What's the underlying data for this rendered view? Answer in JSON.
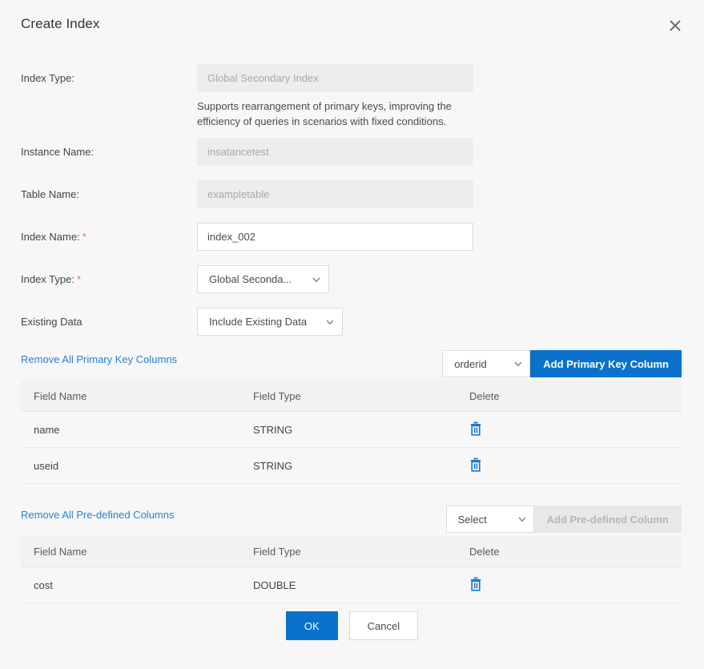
{
  "dialog": {
    "title": "Create Index",
    "close_icon": "close-icon"
  },
  "form": {
    "index_type_readonly": {
      "label": "Index Type:",
      "value": "Global Secondary Index",
      "helper": "Supports rearrangement of primary keys, improving the efficiency of queries in scenarios with fixed conditions."
    },
    "instance_name": {
      "label": "Instance Name:",
      "value": "insatancetest"
    },
    "table_name": {
      "label": "Table Name:",
      "value": "exampletable"
    },
    "index_name": {
      "label": "Index Name:",
      "required_mark": "*",
      "value": "index_002"
    },
    "index_type": {
      "label": "Index Type:",
      "required_mark": "*",
      "value": "Global Seconda..."
    },
    "existing_data": {
      "label": "Existing Data",
      "value": "Include Existing Data"
    }
  },
  "primary_key_section": {
    "remove_all_link": "Remove All Primary Key Columns",
    "select_value": "orderid",
    "add_button": "Add Primary Key Column",
    "columns": [
      "Field Name",
      "Field Type",
      "Delete"
    ],
    "rows": [
      {
        "field_name": "name",
        "field_type": "STRING",
        "delete_icon": "trash-icon"
      },
      {
        "field_name": "useid",
        "field_type": "STRING",
        "delete_icon": "trash-icon"
      }
    ]
  },
  "predefined_section": {
    "remove_all_link": "Remove All Pre-defined Columns",
    "select_value": "Select",
    "add_button": "Add Pre-defined Column",
    "columns": [
      "Field Name",
      "Field Type",
      "Delete"
    ],
    "rows": [
      {
        "field_name": "cost",
        "field_type": "DOUBLE",
        "delete_icon": "trash-icon"
      }
    ]
  },
  "footer": {
    "ok_label": "OK",
    "cancel_label": "Cancel"
  },
  "colors": {
    "primary_blue": "#0a72cc",
    "link_blue": "#2b7fd3",
    "required_red": "#e8684a",
    "background": "#f7f7f8"
  }
}
